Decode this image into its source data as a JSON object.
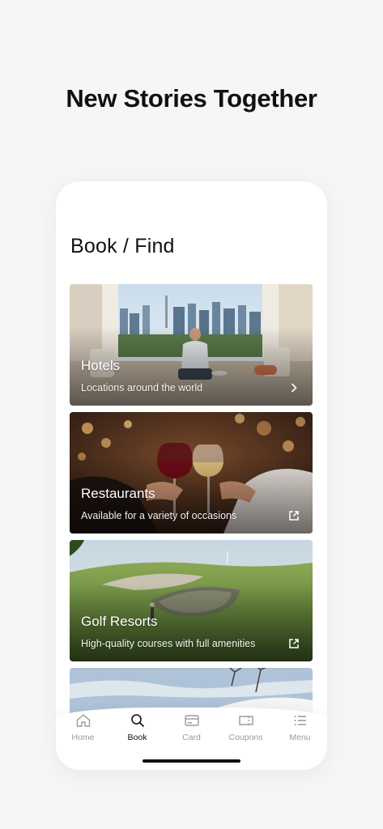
{
  "headline": "New Stories Together",
  "screen": {
    "title": "Book / Find",
    "cards": [
      {
        "title": "Hotels",
        "subtitle": "Locations around the world",
        "icon": "chevron-right-icon"
      },
      {
        "title": "Restaurants",
        "subtitle": "Available for a variety of occasions",
        "icon": "external-link-icon"
      },
      {
        "title": "Golf Resorts",
        "subtitle": "High-quality courses with full amenities",
        "icon": "external-link-icon"
      }
    ]
  },
  "tabbar": {
    "items": [
      {
        "label": "Home",
        "icon": "home-icon"
      },
      {
        "label": "Book",
        "icon": "search-icon",
        "active": true
      },
      {
        "label": "Card",
        "icon": "card-icon"
      },
      {
        "label": "Coupons",
        "icon": "coupon-icon"
      },
      {
        "label": "Menu",
        "icon": "menu-icon"
      }
    ]
  },
  "colors": {
    "background": "#f6f6f7",
    "active_tab": "#111111",
    "inactive_tab": "#9a9a9a"
  }
}
